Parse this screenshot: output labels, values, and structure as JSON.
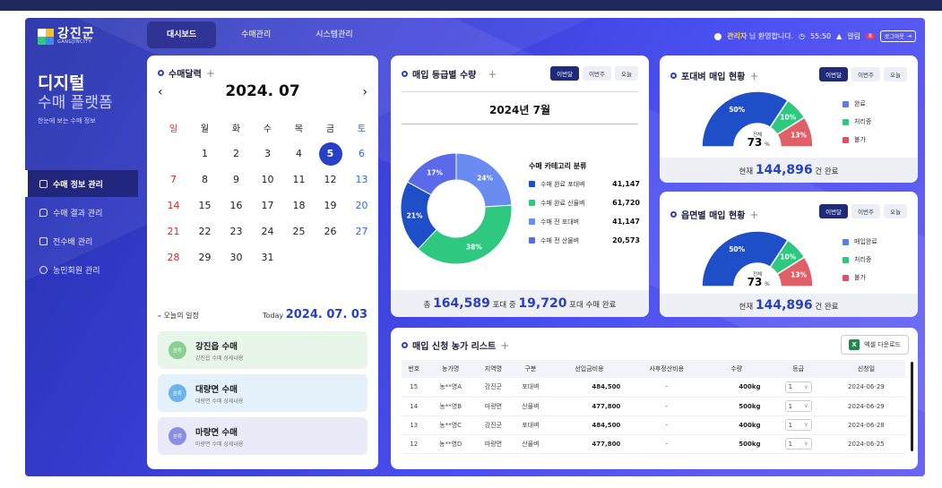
{
  "header": {
    "logo_name": "강진군",
    "logo_sub": "GANGJINCITY",
    "nav_tabs": [
      "대시보드",
      "수매관리",
      "시스템관리"
    ],
    "user_name": "관리자",
    "greeting": "님 환영합니다.",
    "timer": "55:50",
    "alert_label": "알림",
    "alert_count": "8",
    "logout_label": "로그아웃"
  },
  "sidebar": {
    "title1": "디지털",
    "title2": "수매 플랫폼",
    "subtitle": "한눈에 보는 수매 정보",
    "items": [
      {
        "label": "수매 정보 관리"
      },
      {
        "label": "수매 결과 관리"
      },
      {
        "label": "전수배 관리"
      },
      {
        "label": "농민회원 관리"
      }
    ]
  },
  "calendar": {
    "title": "수매달력",
    "month": "2024. 07",
    "weekdays": [
      "일",
      "월",
      "화",
      "수",
      "목",
      "금",
      "토"
    ],
    "days": [
      "",
      "1",
      "2",
      "3",
      "4",
      "5",
      "6",
      "7",
      "8",
      "9",
      "10",
      "11",
      "12",
      "13",
      "14",
      "15",
      "16",
      "17",
      "18",
      "19",
      "20",
      "21",
      "22",
      "23",
      "24",
      "25",
      "26",
      "27",
      "28",
      "29",
      "30",
      "31"
    ],
    "today_index": 5,
    "schedule_label": "오늘의 일정",
    "today_label": "Today",
    "today_date": "2024. 07. 03",
    "schedule": [
      {
        "badge": "분류",
        "title": "강진읍 수매",
        "desc": "강진읍 수매 상세내용",
        "bg": "#e7f6e9",
        "badge_color": "#8ccf94"
      },
      {
        "badge": "분류",
        "title": "대량면 수매",
        "desc": "대량면 수매 상세내용",
        "bg": "#e4f1fb",
        "badge_color": "#6cb4ea"
      },
      {
        "badge": "분류",
        "title": "마량면 수매",
        "desc": "마량면 수매 상세내용",
        "bg": "#eaeaf8",
        "badge_color": "#8a8ee0"
      }
    ]
  },
  "grade": {
    "title": "매입 등급별 수량",
    "seg": [
      "이번달",
      "이번주",
      "오늘"
    ],
    "subtitle": "2024년 7월",
    "legend_title": "수매 카테고리 분류",
    "legend": [
      {
        "label": "수매 완료 포대벼",
        "value": "41,147",
        "color": "#1f4fc8"
      },
      {
        "label": "수매 완료 산물벼",
        "value": "61,720",
        "color": "#2fc880"
      },
      {
        "label": "수매 전 포대벼",
        "value": "41,147",
        "color": "#6a8cf0"
      },
      {
        "label": "수매 전 산물벼",
        "value": "20,573",
        "color": "#5a6ae8"
      }
    ],
    "chart_data": {
      "type": "pie",
      "slices": [
        {
          "label": "24%",
          "value": 24,
          "color": "#6a8cf0"
        },
        {
          "label": "38%",
          "value": 38,
          "color": "#2fc880"
        },
        {
          "label": "21%",
          "value": 21,
          "color": "#1f4fc8"
        },
        {
          "label": "17%",
          "value": 17,
          "color": "#5a6ae8"
        }
      ]
    },
    "foot_pre": "총",
    "foot_total": "164,589",
    "foot_mid": "포대 중",
    "foot_done": "19,720",
    "foot_post": "포대 수매 완료"
  },
  "sack": {
    "title": "포대벼 매입 현황",
    "seg": [
      "이번달",
      "이번주",
      "오늘"
    ],
    "legend": [
      {
        "label": "완료",
        "color": "#5a7ef0"
      },
      {
        "label": "처리중",
        "color": "#2fc880"
      },
      {
        "label": "불가",
        "color": "#e0506a"
      }
    ],
    "chart_data": {
      "type": "pie",
      "segments": [
        {
          "label": "50%",
          "value": 50,
          "color": "#1f4fc8"
        },
        {
          "label": "10%",
          "value": 10,
          "color": "#2fc880"
        },
        {
          "label": "13%",
          "value": 13,
          "color": "#e0606a"
        }
      ]
    },
    "center_label": "전체",
    "center_value": "73",
    "center_unit": "%",
    "foot_pre": "현재",
    "foot_value": "144,896",
    "foot_post": "건 완료"
  },
  "town": {
    "title": "읍면별 매입 현황",
    "seg": [
      "이번달",
      "이번주",
      "오늘"
    ],
    "legend": [
      {
        "label": "매입완료",
        "color": "#5a7ef0"
      },
      {
        "label": "처리중",
        "color": "#2fc880"
      },
      {
        "label": "불가",
        "color": "#e0506a"
      }
    ],
    "chart_data": {
      "type": "pie",
      "segments": [
        {
          "label": "50%",
          "value": 50,
          "color": "#1f4fc8"
        },
        {
          "label": "10%",
          "value": 10,
          "color": "#2fc880"
        },
        {
          "label": "13%",
          "value": 13,
          "color": "#e0606a"
        }
      ]
    },
    "center_label": "전체",
    "center_value": "73",
    "center_unit": "%",
    "foot_pre": "현재",
    "foot_value": "144,896",
    "foot_post": "건 완료"
  },
  "table": {
    "title": "매입 신청 농가 리스트",
    "excel_label": "엑셀 다운로드",
    "columns": [
      "번호",
      "농가명",
      "지역명",
      "구분",
      "선입금비용",
      "사후정산비용",
      "수량",
      "등급",
      "신청일"
    ],
    "rows": [
      [
        "15",
        "농**영A",
        "강진군",
        "포대벼",
        "484,500",
        "-",
        "400kg",
        "1",
        "2024-06-29"
      ],
      [
        "14",
        "농**영B",
        "마량면",
        "산물벼",
        "477,800",
        "-",
        "500kg",
        "1",
        "2024-06-29"
      ],
      [
        "13",
        "농**영C",
        "강진군",
        "포대벼",
        "484,500",
        "-",
        "400kg",
        "1",
        "2024-06-28"
      ],
      [
        "12",
        "농**영D",
        "마량면",
        "산물벼",
        "477,800",
        "-",
        "500kg",
        "1",
        "2024-06-25"
      ]
    ]
  }
}
